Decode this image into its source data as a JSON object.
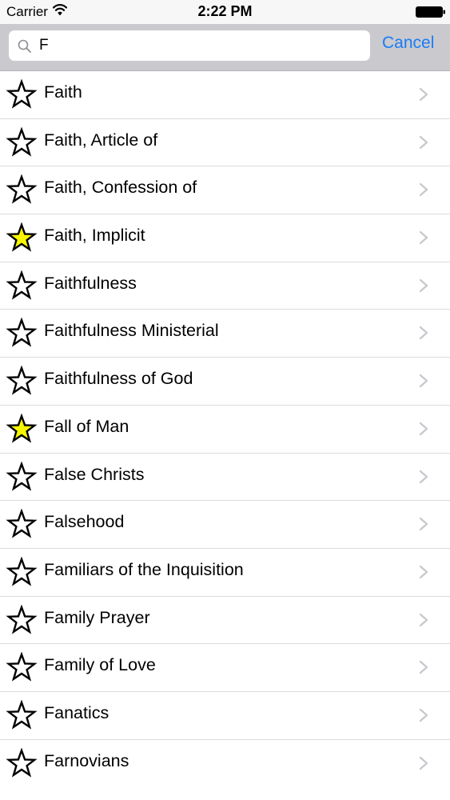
{
  "status_bar": {
    "carrier": "Carrier",
    "time": "2:22 PM"
  },
  "search": {
    "value": "F",
    "cancel_label": "Cancel"
  },
  "colors": {
    "accent": "#1a7cf5",
    "star_favorite": "#f7f700",
    "search_bar_bg": "#c9c9ce"
  },
  "topics": [
    {
      "label": "Faith",
      "favorite": false
    },
    {
      "label": "Faith, Article of",
      "favorite": false
    },
    {
      "label": "Faith, Confession of",
      "favorite": false
    },
    {
      "label": "Faith, Implicit",
      "favorite": true
    },
    {
      "label": "Faithfulness",
      "favorite": false
    },
    {
      "label": "Faithfulness Ministerial",
      "favorite": false
    },
    {
      "label": "Faithfulness of God",
      "favorite": false
    },
    {
      "label": "Fall of Man",
      "favorite": true
    },
    {
      "label": "False Christs",
      "favorite": false
    },
    {
      "label": "Falsehood",
      "favorite": false
    },
    {
      "label": "Familiars of the Inquisition",
      "favorite": false
    },
    {
      "label": "Family Prayer",
      "favorite": false
    },
    {
      "label": "Family of Love",
      "favorite": false
    },
    {
      "label": "Fanatics",
      "favorite": false
    },
    {
      "label": "Farnovians",
      "favorite": false
    }
  ]
}
